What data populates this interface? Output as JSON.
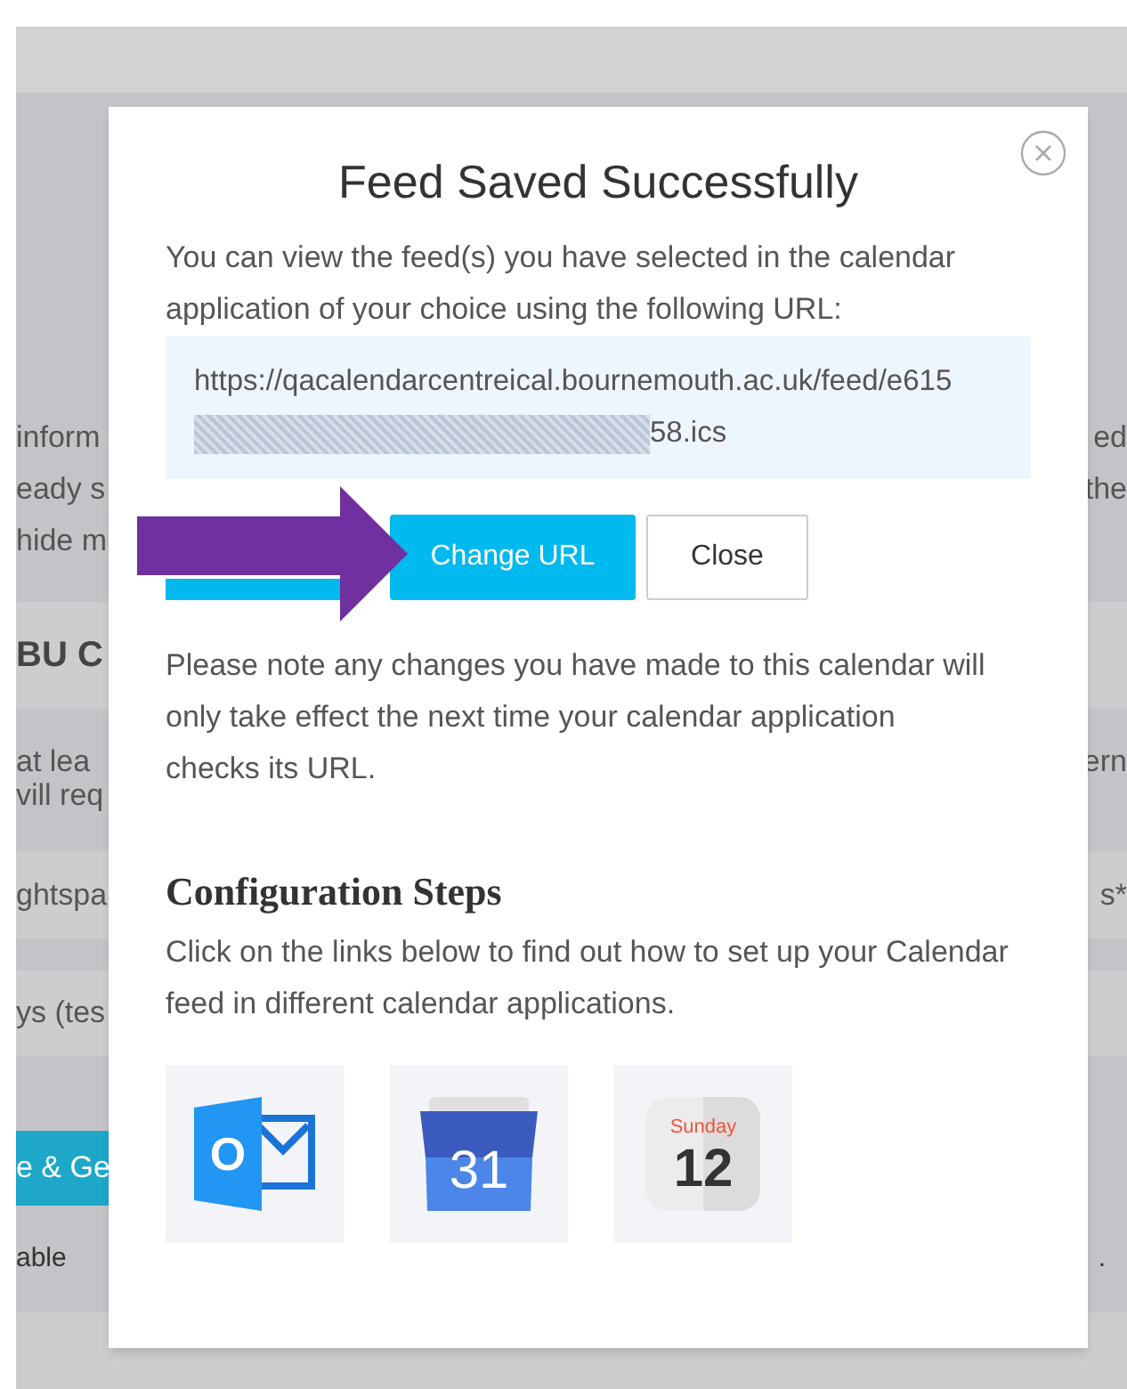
{
  "background": {
    "left_texts": [
      "inform",
      "eady s",
      "hide m"
    ],
    "right_texts": [
      "ed",
      "the"
    ],
    "section_title": "BU C",
    "rows": [
      {
        "left": [
          "at lea",
          "vill req"
        ],
        "right": [
          "ern"
        ]
      },
      {
        "left": [
          "ghtspa"
        ],
        "right": [
          "s*"
        ]
      },
      {
        "left": [
          "ys (tes"
        ],
        "right": []
      }
    ],
    "button": "e & Ge",
    "footer_left": "able",
    "footer_right": "."
  },
  "dialog": {
    "title": "Feed Saved Successfully",
    "intro": "You can view the feed(s) you have selected in the calendar application of your choice using the following URL:",
    "url_start": "https://qacalendarcentreical.bournemouth.ac.uk/feed/e615",
    "url_end": "58.ics",
    "buttons": [
      {
        "label": "Change URL",
        "kind": "primary"
      },
      {
        "label": "Close",
        "kind": "secondary"
      }
    ],
    "note": "Please note any changes you have made to this calendar will only take effect the next time your calendar application checks its URL.",
    "config_title": "Configuration Steps",
    "config_text": "Click on the links below to find out how to set up your Calendar feed in different calendar applications.",
    "apps": [
      {
        "kind": "outlook",
        "letter": "O"
      },
      {
        "kind": "google",
        "day": "31"
      },
      {
        "kind": "apple",
        "weekday": "Sunday",
        "day": "12"
      }
    ]
  }
}
